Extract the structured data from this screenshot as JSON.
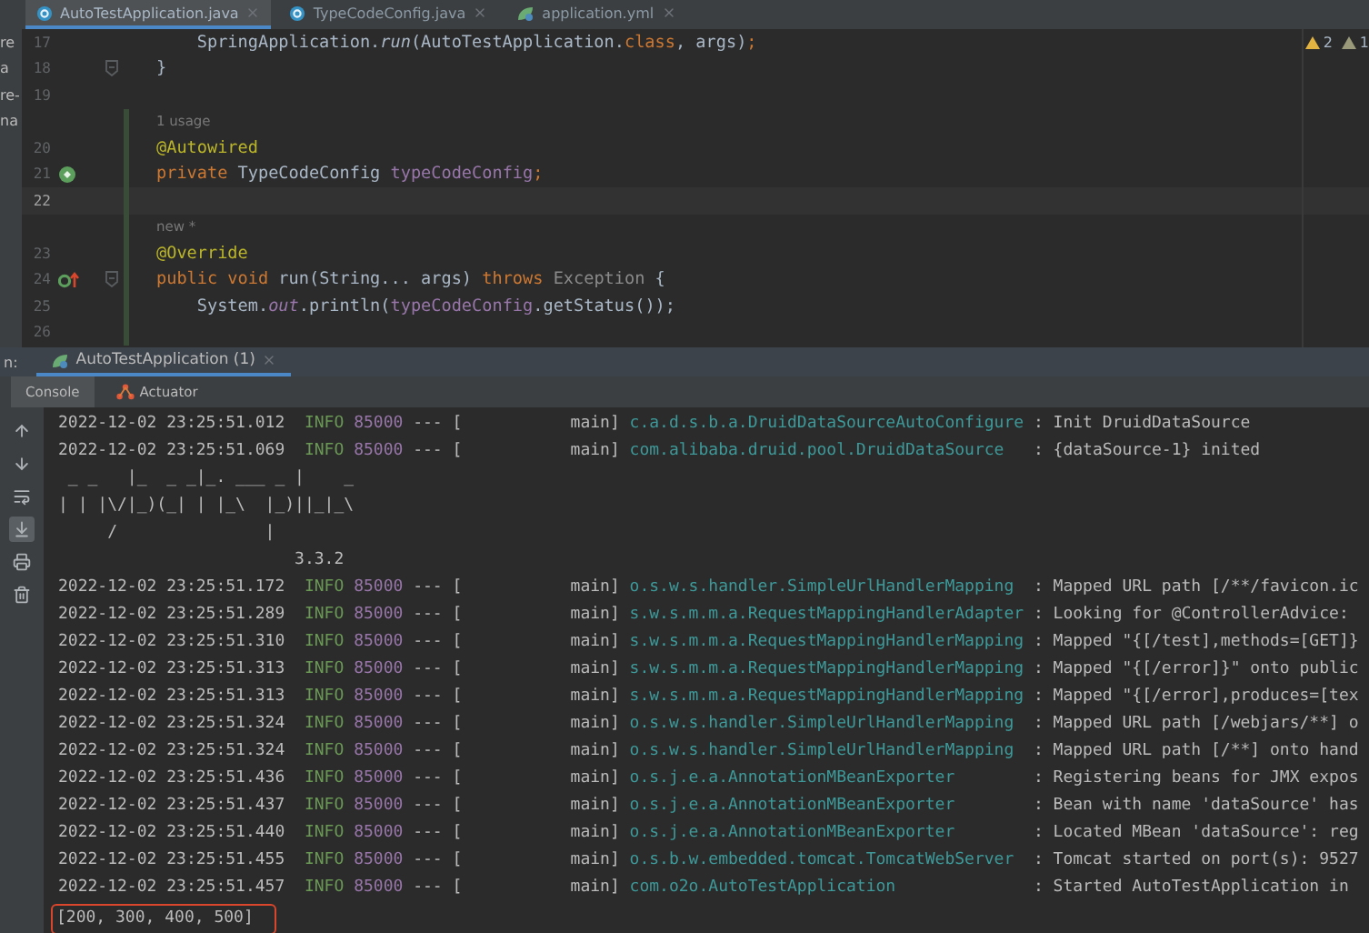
{
  "file_tabs": [
    {
      "label": "AutoTestApplication.java",
      "kind": "java",
      "selected": true
    },
    {
      "label": "TypeCodeConfig.java",
      "kind": "java",
      "selected": false
    },
    {
      "label": "application.yml",
      "kind": "yml",
      "selected": false
    }
  ],
  "inspections": [
    {
      "kind": "warning",
      "count": "2"
    },
    {
      "kind": "weak",
      "count": "1"
    }
  ],
  "editor_lines": [
    {
      "kind": "code",
      "number": "17",
      "side": "re",
      "changed": false,
      "current": false,
      "fold": false,
      "tokens": [
        {
          "text": "    SpringApplication.",
          "kind": "plain"
        },
        {
          "text": "run",
          "kind": "italic"
        },
        {
          "text": "(AutoTestApplication.",
          "kind": "plain"
        },
        {
          "text": "class",
          "kind": "keyword"
        },
        {
          "text": ", args)",
          "kind": "plain"
        },
        {
          "text": ";",
          "kind": "keyword"
        }
      ]
    },
    {
      "kind": "code",
      "number": "18",
      "side": "a",
      "changed": false,
      "current": false,
      "fold": true,
      "tokens": [
        {
          "text": "}",
          "kind": "plain"
        }
      ]
    },
    {
      "kind": "code",
      "number": "19",
      "side": "re-",
      "changed": false,
      "current": false,
      "fold": false
    },
    {
      "kind": "hint",
      "text": "1 usage",
      "side": "na",
      "changed": true
    },
    {
      "kind": "code",
      "number": "20",
      "changed": true,
      "current": false,
      "fold": false,
      "tokens": [
        {
          "text": "@Autowired",
          "kind": "annotation"
        }
      ]
    },
    {
      "kind": "code",
      "number": "21",
      "gutter_icon": {
        "kind": "bean"
      },
      "changed": true,
      "current": false,
      "fold": false,
      "tokens": [
        {
          "text": "private",
          "kind": "keyword"
        },
        {
          "text": " TypeCodeConfig ",
          "kind": "plain"
        },
        {
          "text": "typeCodeConfig",
          "kind": "field"
        },
        {
          "text": ";",
          "kind": "keyword"
        }
      ]
    },
    {
      "kind": "code",
      "number": "22",
      "changed": true,
      "current": true,
      "fold": false
    },
    {
      "kind": "hint",
      "text": "new *",
      "changed": true
    },
    {
      "kind": "code",
      "number": "23",
      "changed": true,
      "current": false,
      "fold": false,
      "tokens": [
        {
          "text": "@Override",
          "kind": "annotation"
        }
      ]
    },
    {
      "kind": "code",
      "number": "24",
      "gutter_icon": {
        "kind": "override"
      },
      "changed": true,
      "current": false,
      "fold": true,
      "tokens": [
        {
          "text": "public void",
          "kind": "keyword"
        },
        {
          "text": " run",
          "kind": "plain"
        },
        {
          "text": "(String... args) ",
          "kind": "plain"
        },
        {
          "text": "throws",
          "kind": "keyword"
        },
        {
          "text": " Exception",
          "kind": "muted"
        },
        {
          "text": " {",
          "kind": "plain"
        }
      ]
    },
    {
      "kind": "code",
      "number": "25",
      "changed": true,
      "current": false,
      "fold": false,
      "tokens": [
        {
          "text": "    System.",
          "kind": "plain"
        },
        {
          "text": "out",
          "kind": "static"
        },
        {
          "text": ".println(",
          "kind": "plain"
        },
        {
          "text": "typeCodeConfig",
          "kind": "field"
        },
        {
          "text": ".getStatus());",
          "kind": "plain"
        }
      ]
    },
    {
      "kind": "code",
      "number": "26",
      "changed": true,
      "current": false,
      "fold": false
    }
  ],
  "run_panel": {
    "label": "n:",
    "tab": {
      "label": "AutoTestApplication (1)",
      "selected": true
    }
  },
  "console_tabs": [
    {
      "label": "Console",
      "kind": "console",
      "selected": true
    },
    {
      "label": "Actuator",
      "kind": "actuator",
      "selected": false
    }
  ],
  "console_toolbar": [
    {
      "kind": "up",
      "on": false
    },
    {
      "kind": "down",
      "on": false
    },
    {
      "kind": "wrap",
      "on": false
    },
    {
      "kind": "scroll-end",
      "on": true
    },
    {
      "kind": "print",
      "on": false
    },
    {
      "kind": "trash",
      "on": false
    }
  ],
  "console_lines": [
    {
      "kind": "log",
      "time": "2022-12-02 23:25:51.012",
      "level": "INFO",
      "pid": "85000",
      "thread": "--- [           main]",
      "logger": "c.a.d.s.b.a.DruidDataSourceAutoConfigure",
      "message": ": Init DruidDataSource"
    },
    {
      "kind": "log",
      "time": "2022-12-02 23:25:51.069",
      "level": "INFO",
      "pid": "85000",
      "thread": "--- [           main]",
      "logger": "com.alibaba.druid.pool.DruidDataSource",
      "message": ": {dataSource-1} inited"
    },
    {
      "kind": "banner",
      "text": " _ _   |_  _ _|_. ___ _ |    _"
    },
    {
      "kind": "banner",
      "text": "| | |\\/|_)(_| | |_\\  |_)||_|_\\"
    },
    {
      "kind": "banner",
      "text": "     /               |"
    },
    {
      "kind": "banner",
      "text": "                        3.3.2"
    },
    {
      "kind": "log",
      "time": "2022-12-02 23:25:51.172",
      "level": "INFO",
      "pid": "85000",
      "thread": "--- [           main]",
      "logger": "o.s.w.s.handler.SimpleUrlHandlerMapping",
      "message": ": Mapped URL path [/**/favicon.ic"
    },
    {
      "kind": "log",
      "time": "2022-12-02 23:25:51.289",
      "level": "INFO",
      "pid": "85000",
      "thread": "--- [           main]",
      "logger": "s.w.s.m.m.a.RequestMappingHandlerAdapter",
      "message": ": Looking for @ControllerAdvice:"
    },
    {
      "kind": "log",
      "time": "2022-12-02 23:25:51.310",
      "level": "INFO",
      "pid": "85000",
      "thread": "--- [           main]",
      "logger": "s.w.s.m.m.a.RequestMappingHandlerMapping",
      "message": ": Mapped \"{[/test],methods=[GET]}"
    },
    {
      "kind": "log",
      "time": "2022-12-02 23:25:51.313",
      "level": "INFO",
      "pid": "85000",
      "thread": "--- [           main]",
      "logger": "s.w.s.m.m.a.RequestMappingHandlerMapping",
      "message": ": Mapped \"{[/error]}\" onto public"
    },
    {
      "kind": "log",
      "time": "2022-12-02 23:25:51.313",
      "level": "INFO",
      "pid": "85000",
      "thread": "--- [           main]",
      "logger": "s.w.s.m.m.a.RequestMappingHandlerMapping",
      "message": ": Mapped \"{[/error],produces=[tex"
    },
    {
      "kind": "log",
      "time": "2022-12-02 23:25:51.324",
      "level": "INFO",
      "pid": "85000",
      "thread": "--- [           main]",
      "logger": "o.s.w.s.handler.SimpleUrlHandlerMapping",
      "message": ": Mapped URL path [/webjars/**] o"
    },
    {
      "kind": "log",
      "time": "2022-12-02 23:25:51.324",
      "level": "INFO",
      "pid": "85000",
      "thread": "--- [           main]",
      "logger": "o.s.w.s.handler.SimpleUrlHandlerMapping",
      "message": ": Mapped URL path [/**] onto hand"
    },
    {
      "kind": "log",
      "time": "2022-12-02 23:25:51.436",
      "level": "INFO",
      "pid": "85000",
      "thread": "--- [           main]",
      "logger": "o.s.j.e.a.AnnotationMBeanExporter",
      "message": ": Registering beans for JMX expos"
    },
    {
      "kind": "log",
      "time": "2022-12-02 23:25:51.437",
      "level": "INFO",
      "pid": "85000",
      "thread": "--- [           main]",
      "logger": "o.s.j.e.a.AnnotationMBeanExporter",
      "message": ": Bean with name 'dataSource' has"
    },
    {
      "kind": "log",
      "time": "2022-12-02 23:25:51.440",
      "level": "INFO",
      "pid": "85000",
      "thread": "--- [           main]",
      "logger": "o.s.j.e.a.AnnotationMBeanExporter",
      "message": ": Located MBean 'dataSource': reg"
    },
    {
      "kind": "log",
      "time": "2022-12-02 23:25:51.455",
      "level": "INFO",
      "pid": "85000",
      "thread": "--- [           main]",
      "logger": "o.s.b.w.embedded.tomcat.TomcatWebServer",
      "message": ": Tomcat started on port(s): 9527"
    },
    {
      "kind": "log",
      "time": "2022-12-02 23:25:51.457",
      "level": "INFO",
      "pid": "85000",
      "thread": "--- [           main]",
      "logger": "com.o2o.AutoTestApplication",
      "message": ": Started AutoTestApplication in"
    },
    {
      "kind": "output",
      "text": "[200, 300, 400, 500]",
      "highlighted": true
    }
  ]
}
